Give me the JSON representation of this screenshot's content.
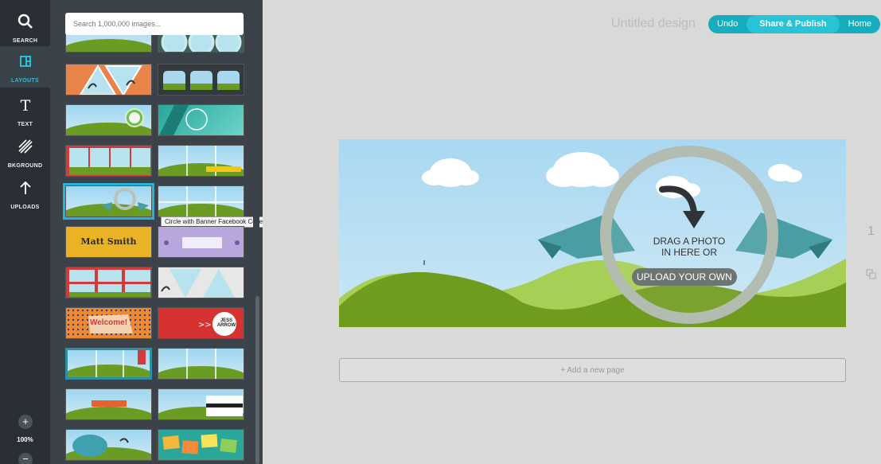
{
  "rail": {
    "items": [
      {
        "label": "SEARCH",
        "icon": "search-icon"
      },
      {
        "label": "LAYOUTS",
        "icon": "layouts-icon"
      },
      {
        "label": "TEXT",
        "icon": "text-icon"
      },
      {
        "label": "BKGROUND",
        "icon": "background-icon"
      },
      {
        "label": "UPLOADS",
        "icon": "upload-icon"
      }
    ],
    "zoom_in": "+",
    "zoom_level": "100%",
    "zoom_out": "−"
  },
  "panel": {
    "search_placeholder": "Search 1,000,000 images...",
    "tooltip": "Circle with Banner Facebook Cover",
    "thumb_texts": {
      "matt": "Matt Smith",
      "welcome": "Welcome!",
      "jess": "JESS ARROW"
    }
  },
  "header": {
    "title": "Untitled design",
    "undo": "Undo",
    "share": "Share & Publish",
    "home": "Home"
  },
  "canvas": {
    "drag_line1": "DRAG A PHOTO",
    "drag_line2": "IN HERE OR",
    "upload": "UPLOAD YOUR OWN"
  },
  "add_page": "+ Add a new page",
  "page_number": "1",
  "colors": {
    "accent": "#27c3d6",
    "rail": "#2a2f35",
    "panel": "#3b424a"
  }
}
